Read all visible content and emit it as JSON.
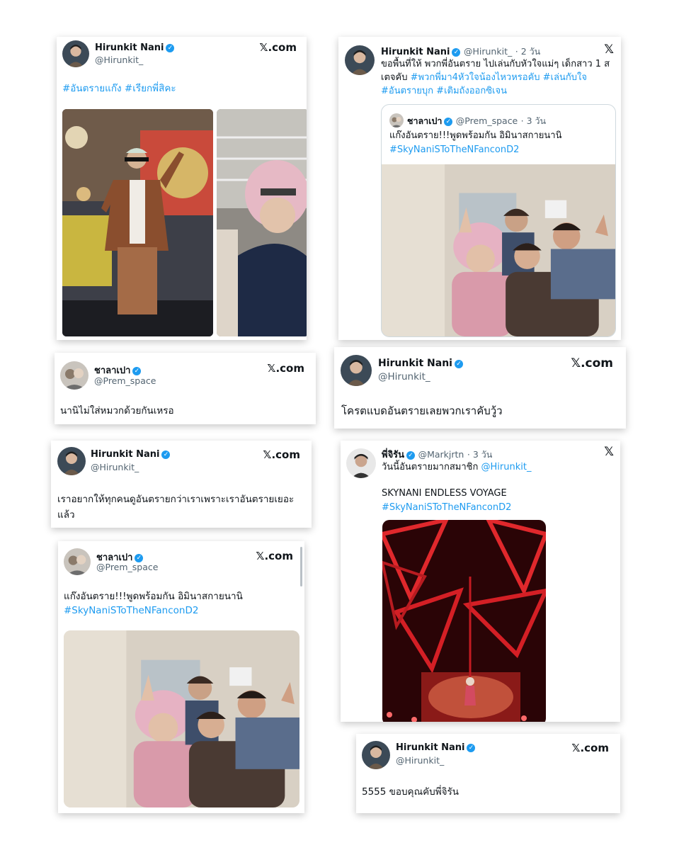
{
  "common": {
    "xcom": "𝕏.com",
    "x_logo": "𝕏",
    "verified_icon": "✓"
  },
  "card1": {
    "name": "Hirunkit Nani",
    "handle": "@Hirunkit_",
    "hashtags": "#อันตรายแก๊ง #เรียกพี่สิคะ"
  },
  "card2": {
    "name": "Hirunkit Nani",
    "handle": "@Hirunkit_",
    "time": "· 2 วัน",
    "text_plain": "ขอพื้นที่ให้ พวกพี่อันตราย ไปเล่นกับหัวใจแม่ๆ เด็กสาว 1 สเตจคับ",
    "text_tags": "#พวกพี่มา4หัวใจน้องไหวหรอคับ #เล่นกับใจ #อันตรายบุก #เติมถังออกซิเจน",
    "quote": {
      "name": "ชาลาเปา",
      "handle": "@Prem_space",
      "time": "· 3 วัน",
      "text": "แก๊งอันตราย!!!พูดพร้อมกัน อิมินาสกายนานิ",
      "tag": "#SkyNaniSToTheNFanconD2"
    }
  },
  "card3": {
    "name": "ชาลาเปา",
    "handle": "@Prem_space",
    "text": "นานิไม่ใส่หมวกด้วยกันเหรอ"
  },
  "card4": {
    "name": "Hirunkit Nani",
    "handle": "@Hirunkit_",
    "text": "โครตแบดอันตรายเลยพวกเราคับวู้ว"
  },
  "card5": {
    "name": "Hirunkit Nani",
    "handle": "@Hirunkit_",
    "text": "เราอยากให้ทุกคนดูอันตรายกว่าเราเพราะเราอันตรายเยอะแล้ว"
  },
  "card6": {
    "name": "พี่จิรัน",
    "handle": "@Markjrtn",
    "time": "· 3 วัน",
    "text1_plain": "วันนี้อันตรายมากสมาชิก",
    "text1_mention": "@Hirunkit_",
    "text2": "SKYNANI ENDLESS VOYAGE",
    "text3": "#SkyNaniSToTheNFanconD2"
  },
  "card7": {
    "name": "ชาลาเปา",
    "handle": "@Prem_space",
    "text": "แก๊งอันตราย!!!พูดพร้อมกัน อิมินาสกายนานิ",
    "tag": "#SkyNaniSToTheNFanconD2"
  },
  "card8": {
    "name": "Hirunkit Nani",
    "handle": "@Hirunkit_",
    "text": "5555 ขอบคุณคับพี่จิรัน"
  },
  "colors": {
    "link": "#1d9bf0",
    "verified": "#1d9bf0",
    "muted": "#536471"
  }
}
